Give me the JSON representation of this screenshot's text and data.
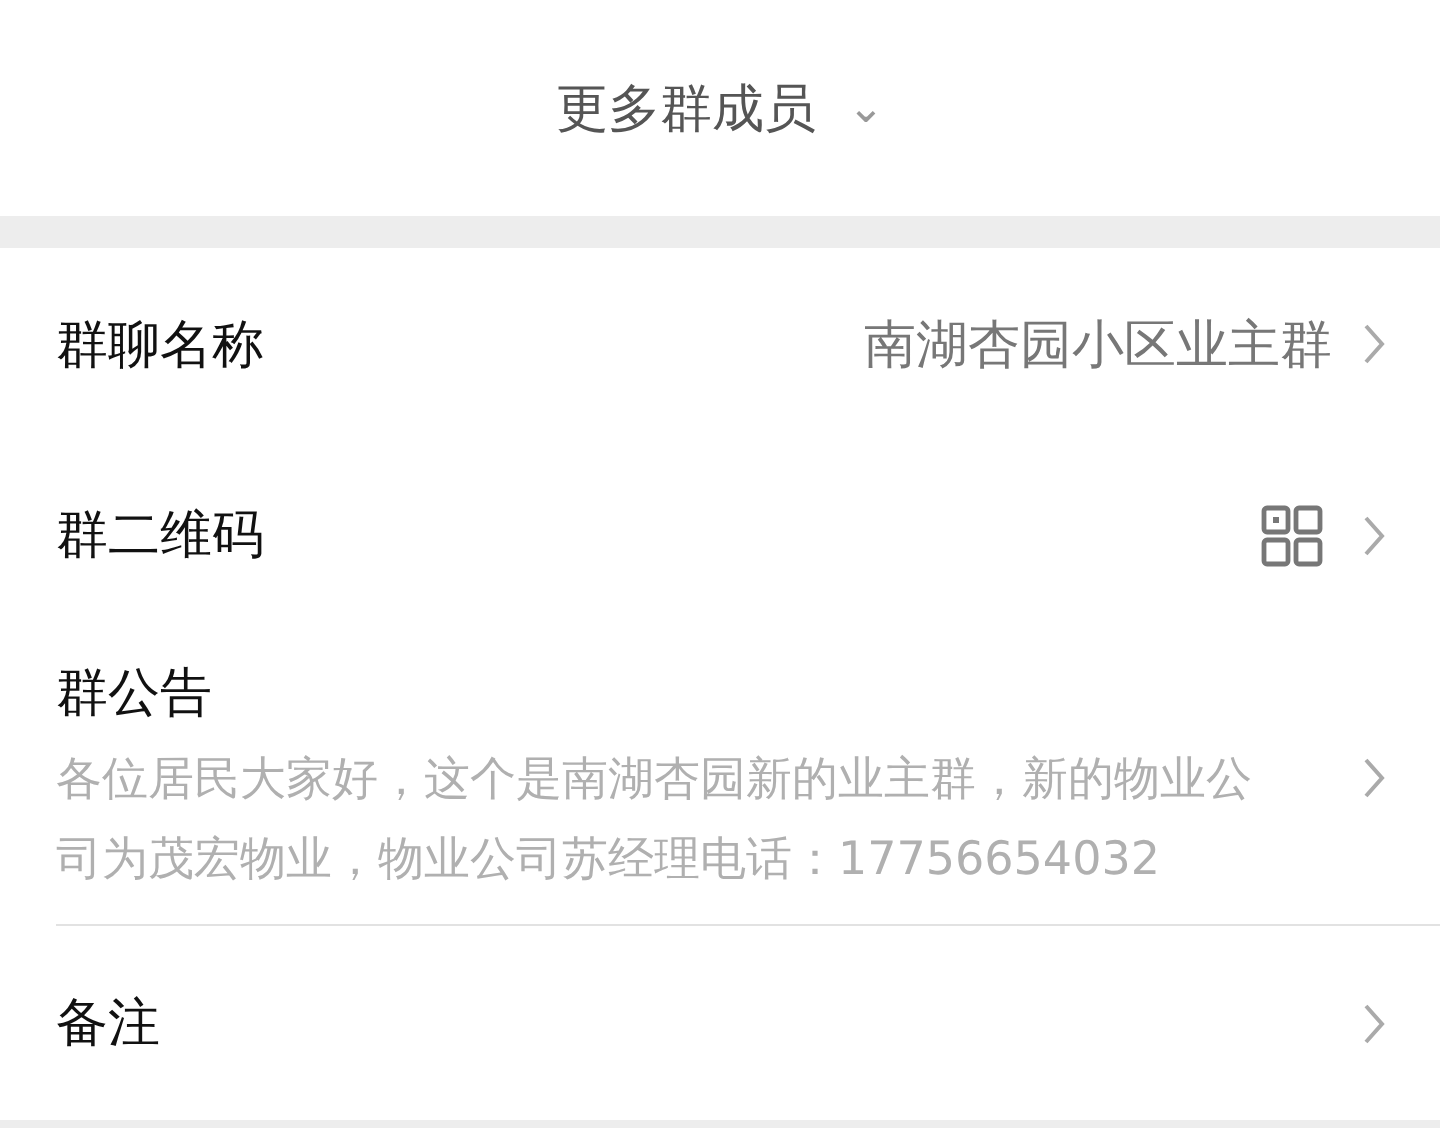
{
  "more_members": {
    "label": "更多群成员",
    "icon": "⌄"
  },
  "rows": [
    {
      "kind": "value",
      "label": "群聊名称",
      "value": "南湖杏园小区业主群"
    },
    {
      "kind": "qrcode",
      "label": "群二维码"
    },
    {
      "kind": "note",
      "label": "群公告",
      "text": "各位居民大家好，这个是南湖杏园新的业主群，新的物业公司为茂宏物业，物业公司苏经理电话：17756654032"
    },
    {
      "kind": "plain",
      "label": "备注"
    }
  ]
}
